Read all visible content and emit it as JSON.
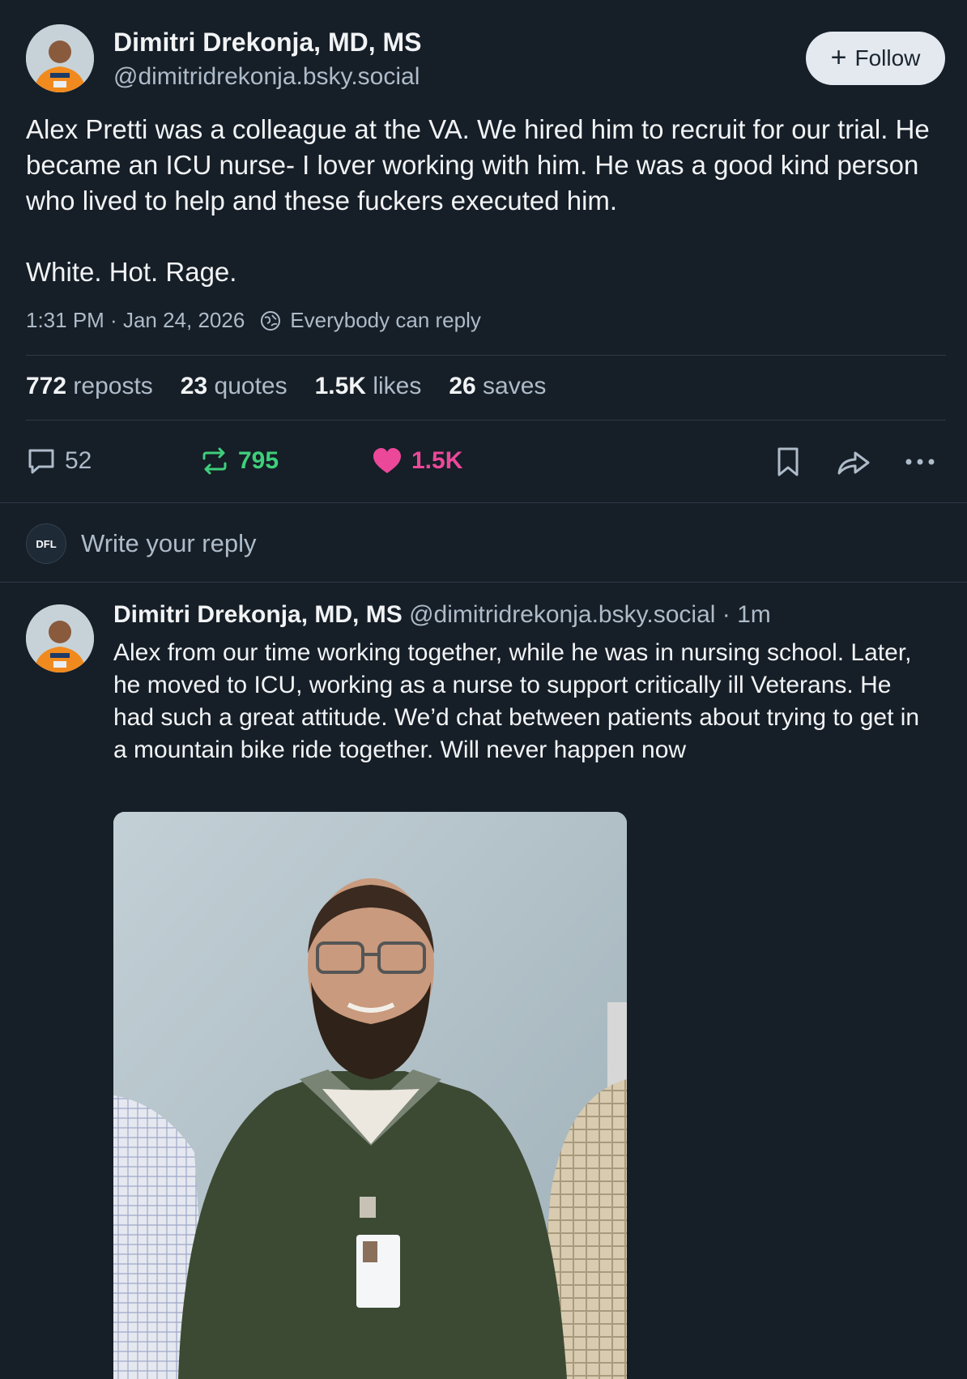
{
  "post": {
    "author_name": "Dimitri Drekonja, MD, MS",
    "author_handle": "@dimitridrekonja.bsky.social",
    "follow_label": "Follow",
    "text_line1": "Alex Pretti was a colleague at the VA. We hired him to recruit for our trial. He became an ICU nurse- I lover working with him. He was a good kind person who lived to help and these fuckers executed him.",
    "text_line2": "White. Hot. Rage.",
    "time": "1:31 PM",
    "date": "Jan 24, 2026",
    "reply_setting": "Everybody can reply",
    "stats": {
      "reposts_value": "772",
      "reposts_label": "reposts",
      "quotes_value": "23",
      "quotes_label": "quotes",
      "likes_value": "1.5K",
      "likes_label": "likes",
      "saves_value": "26",
      "saves_label": "saves"
    },
    "actions": {
      "reply_count": "52",
      "repost_count": "795",
      "like_count": "1.5K"
    }
  },
  "composer": {
    "avatar_text": "DFL",
    "placeholder": "Write your reply"
  },
  "reply": {
    "author_name": "Dimitri Drekonja, MD, MS",
    "author_handle": "@dimitridrekonja.bsky.social",
    "age": "· 1m",
    "text": "Alex from our time working together, while he was in nursing school. Later, he moved to ICU, working as a nurse to support critically ill Veterans. He had such a great attitude. We’d chat between patients about trying to get in a mountain bike ride together. Will never happen now"
  },
  "colors": {
    "background": "#161e27",
    "repost_green": "#3ecf7a",
    "like_pink": "#ec4899",
    "muted_text": "#aebbc9"
  },
  "icons": [
    "reply-bubble-icon",
    "repost-icon",
    "heart-icon",
    "bookmark-icon",
    "share-icon",
    "more-icon",
    "globe-icon",
    "plus-icon"
  ]
}
